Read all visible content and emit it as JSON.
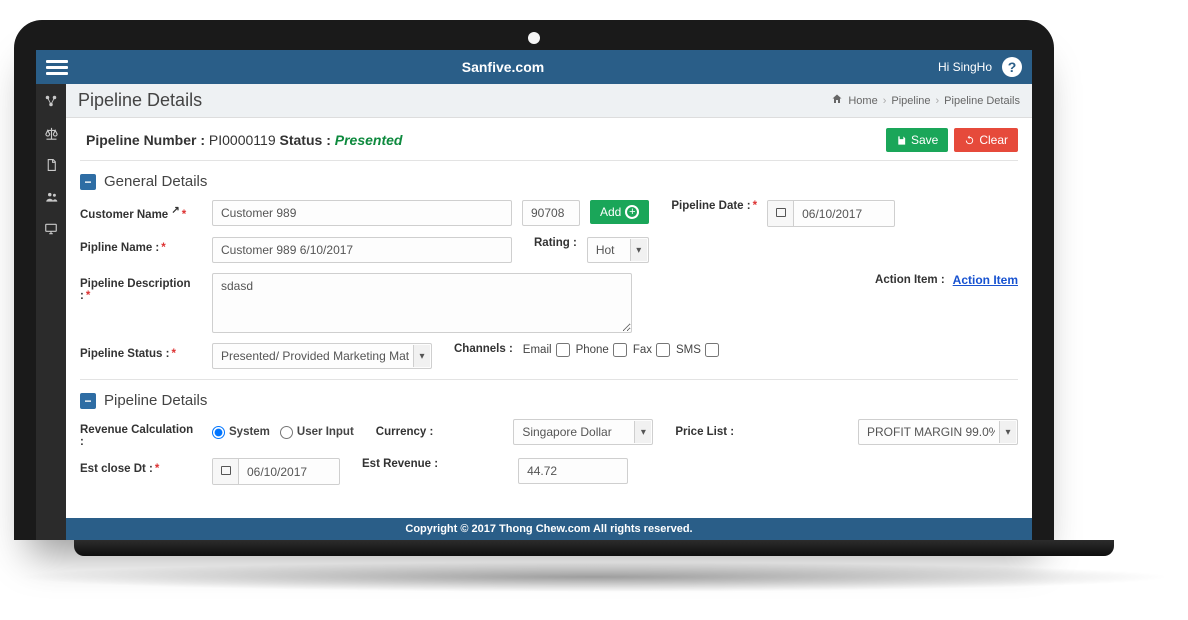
{
  "topbar": {
    "brand": "Sanfive.com",
    "greeting": "Hi SingHo"
  },
  "sidebar": {
    "icons": [
      "cluster-icon",
      "balance-icon",
      "document-icon",
      "users-icon",
      "monitor-icon"
    ]
  },
  "header": {
    "title": "Pipeline Details",
    "breadcrumb": {
      "home": "Home",
      "pipeline": "Pipeline",
      "details": "Pipeline Details"
    }
  },
  "status": {
    "label_number": "Pipeline Number :",
    "number": "PI0000119",
    "label_status": "Status :",
    "value": "Presented"
  },
  "buttons": {
    "save": "Save",
    "clear": "Clear",
    "add": "Add"
  },
  "sections": {
    "general": "General Details",
    "pipeline": "Pipeline Details"
  },
  "labels": {
    "customer_name": "Customer Name",
    "pipeline_date": "Pipeline Date :",
    "pipline_name": "Pipline Name :",
    "rating": "Rating :",
    "pipeline_description": "Pipeline Description :",
    "action_item_lbl": "Action Item :",
    "action_item_link": "Action Item",
    "pipeline_status": "Pipeline Status :",
    "channels": "Channels :",
    "email": "Email",
    "phone": "Phone",
    "fax": "Fax",
    "sms": "SMS",
    "revenue_calc": "Revenue Calculation :",
    "system": "System",
    "user_input": "User Input",
    "currency": "Currency :",
    "price_list": "Price List :",
    "est_close": "Est close Dt :",
    "est_revenue": "Est Revenue :"
  },
  "values": {
    "customer_name": "Customer 989",
    "customer_code": "90708",
    "pipeline_date": "06/10/2017",
    "pipline_name": "Customer 989 6/10/2017",
    "rating": "Hot",
    "description": "sdasd",
    "status_select": "Presented/ Provided Marketing Material",
    "currency": "Singapore Dollar",
    "price_list": "PROFIT MARGIN 99.0%",
    "est_close": "06/10/2017",
    "est_revenue": "44.72"
  },
  "footer": "Copyright © 2017 Thong Chew.com All rights reserved."
}
